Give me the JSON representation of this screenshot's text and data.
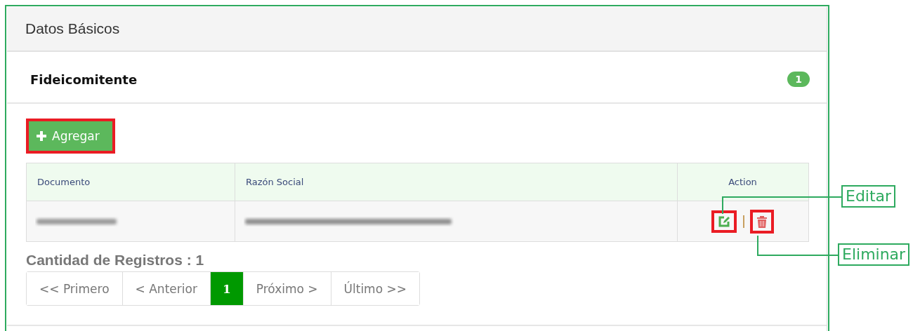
{
  "panel": {
    "title": "Datos Básicos"
  },
  "section": {
    "title": "Fideicomitente",
    "badge": "1"
  },
  "add_button": {
    "label": "Agregar"
  },
  "table": {
    "columns": [
      "Documento",
      "Razón Social",
      "Action"
    ],
    "rows": [
      {
        "kind": "redacted"
      }
    ]
  },
  "total": "Cantidad de Registros : 1",
  "pagination": [
    {
      "label": "<< Primero",
      "selected": false
    },
    {
      "label": "< Anterior",
      "selected": false
    },
    {
      "label": "1",
      "selected": true
    },
    {
      "label": "Próximo >",
      "selected": false
    },
    {
      "label": "Último >>",
      "selected": false
    }
  ],
  "callouts": [
    {
      "label": "Editar"
    },
    {
      "label": "Eliminar"
    }
  ]
}
